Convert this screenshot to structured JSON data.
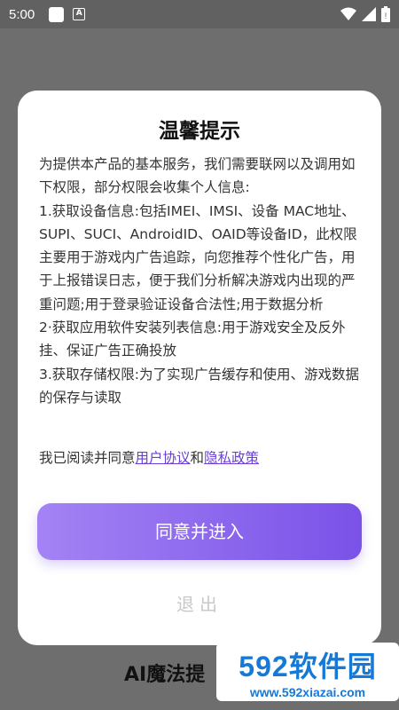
{
  "status_bar": {
    "time": "5:00",
    "icons": [
      "app-square-icon",
      "a-letter-icon",
      "wifi-icon",
      "signal-icon",
      "battery-icon"
    ]
  },
  "background": {
    "title_partial": "AI魔法提"
  },
  "dialog": {
    "title": "温馨提示",
    "intro": "为提供本产品的基本服务，我们需要联网以及调用如下权限，部分权限会收集个人信息:",
    "items": [
      " 1.获取设备信息:包括IMEI、IMSI、设备 MAC地址、SUPI、SUCI、AndroidID、OAID等设备ID，此权限主要用于游戏内广告追踪，向您推荐个性化广告，用于上报错误日志，便于我们分析解决游戏内出现的严重问题;用于登录验证设备合法性;用于数据分析",
      " 2·获取应用软件安装列表信息:用于游戏安全及反外挂、保证广告正确投放",
      " 3.获取存储权限:为了实现广告缓存和使用、游戏数据的保存与读取"
    ],
    "consent_prefix": "我已阅读并同意",
    "user_agreement_link": "用户协议",
    "consent_and": "和",
    "privacy_policy_link": "隐私政策",
    "agree_button": "同意并进入",
    "exit_button": "退出"
  },
  "watermark": {
    "main": "592软件园",
    "sub": "www.592xiazai.com"
  },
  "colors": {
    "accent_start": "#a383f4",
    "accent_end": "#7a52e8",
    "link": "#6a3fd9",
    "overlay": "#6e6e6e"
  }
}
